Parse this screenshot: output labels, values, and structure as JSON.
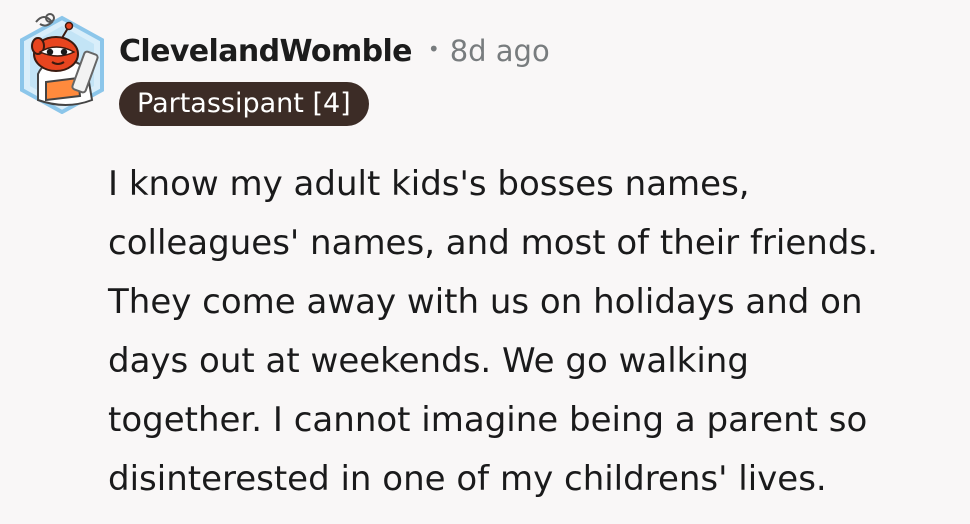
{
  "comment": {
    "author": "ClevelandWomble",
    "separator": "•",
    "timestamp": "8d ago",
    "flair": "Partassipant [4]",
    "avatar_icon": "snoo-avatar-icon",
    "body_lines": [
      "I know my adult kids's bosses names,",
      "colleagues' names, and most of their friends.",
      "They come away with us on holidays and on",
      "days out at weekends. We go walking",
      "together. I cannot imagine being a parent so",
      "disinterested in one of my childrens' lives."
    ]
  },
  "colors": {
    "background": "#f9f7f7",
    "flair_background": "#3c2c26",
    "avatar_orange": "#e8451f",
    "avatar_frame": "#6fb7e6"
  }
}
